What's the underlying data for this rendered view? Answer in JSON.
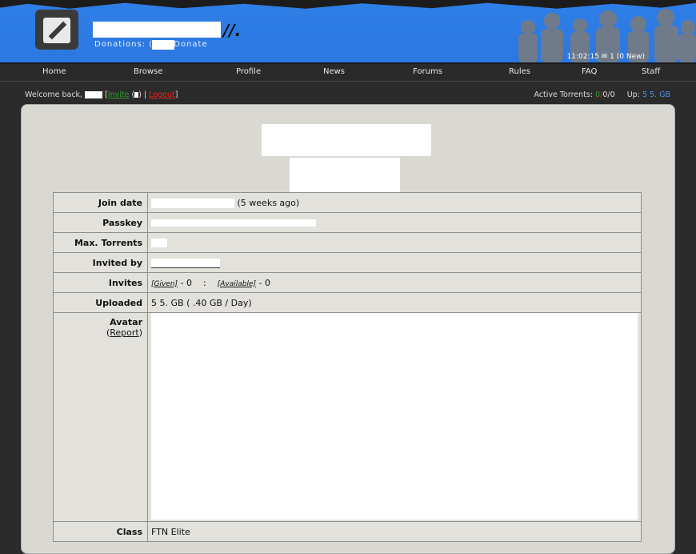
{
  "header": {
    "donations_text": "Donations: (    ) // Donate",
    "clock": "11:02:15 ✉ 1 (0 New)"
  },
  "nav": {
    "items": [
      "Home",
      "Browse",
      "Profile",
      "News",
      "Forums",
      "Rules",
      "FAQ",
      "Staff"
    ]
  },
  "welcome": {
    "prefix": "Welcome back,",
    "invite_label": "Invite",
    "logout_label": "Logout"
  },
  "stats": {
    "active_label": "Active Torrents:",
    "seeding": "0",
    "leeching": "0",
    "other": "0",
    "up_label": "Up:",
    "up_value": "5 5.",
    "up_unit": "GB"
  },
  "profile": {
    "join_date_label": "Join date",
    "join_date_suffix": "(5   weeks ago)",
    "passkey_label": "Passkey",
    "max_torrents_label": "Max. Torrents",
    "invited_by_label": "Invited by",
    "invites_label": "Invites",
    "invites_given": "[Given]",
    "invites_given_count": "- 0",
    "invites_available": "[Available]",
    "invites_available_count": "- 0",
    "uploaded_label": "Uploaded",
    "uploaded_value_prefix": "5 5.",
    "uploaded_value_suffix": "GB (  .40 GB / Day)",
    "avatar_label": "Avatar",
    "avatar_report": "Report",
    "class_label": "Class",
    "class_value": "FTN Elite"
  }
}
